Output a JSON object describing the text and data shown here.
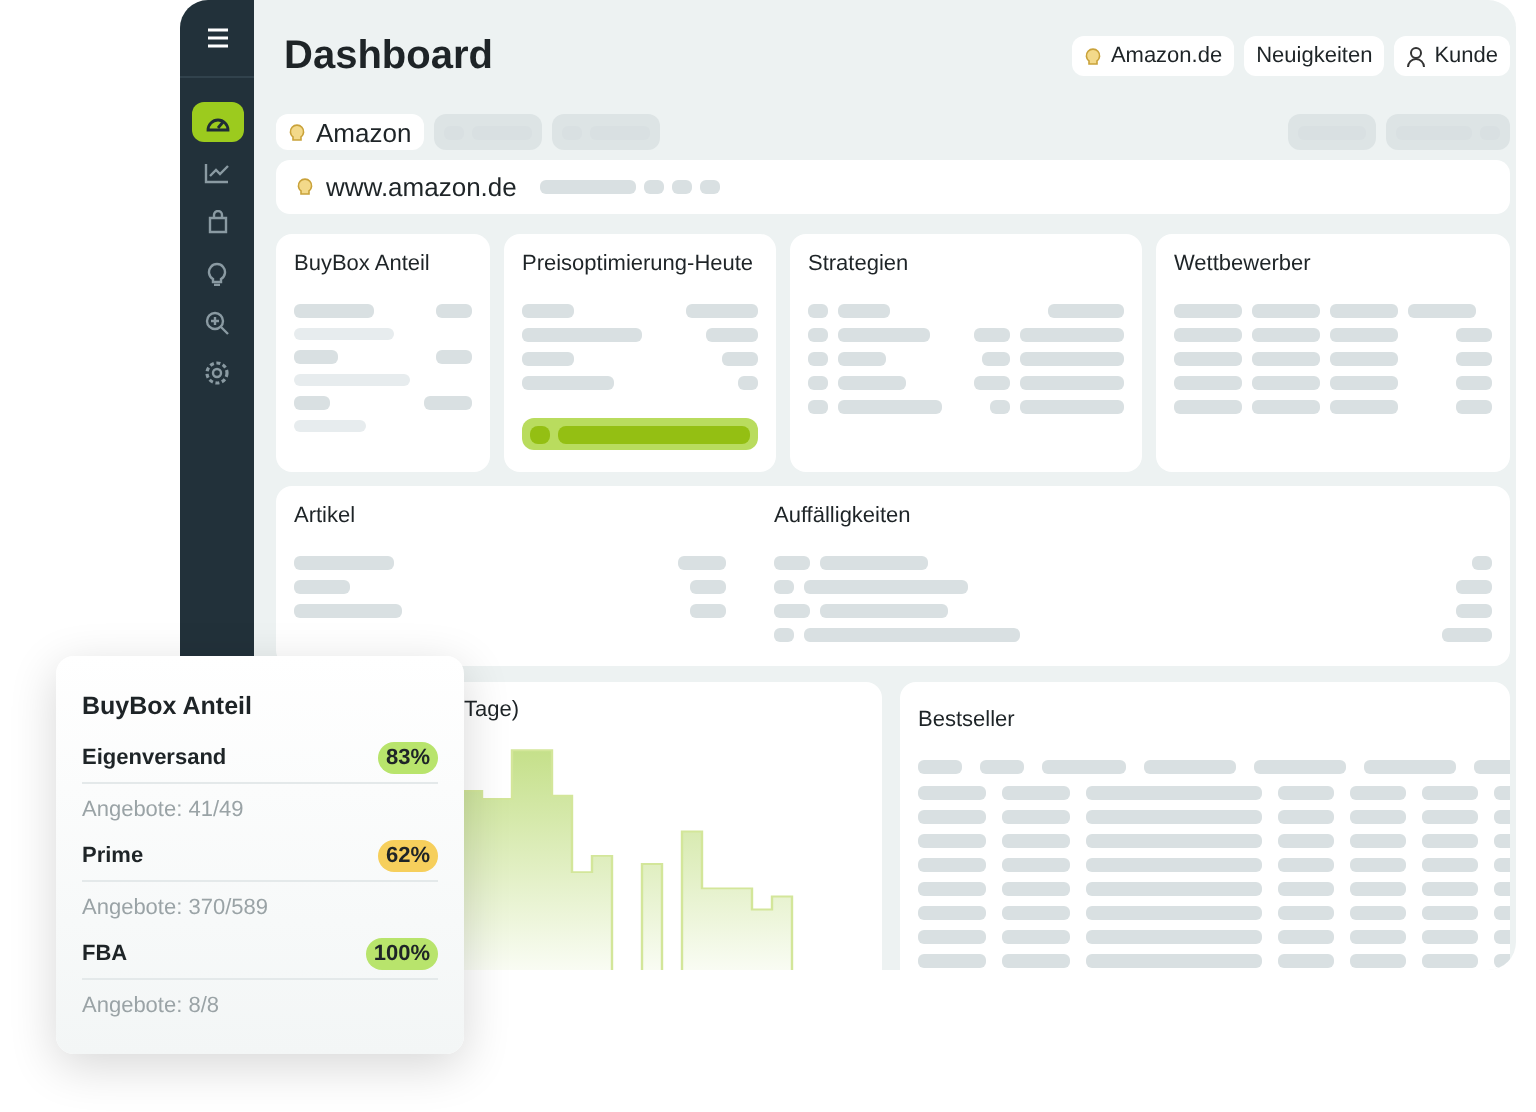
{
  "sidebar": {
    "items": [
      {
        "selected": true
      },
      {
        "selected": false
      },
      {
        "selected": false
      },
      {
        "selected": false
      },
      {
        "selected": false
      },
      {
        "selected": false
      }
    ]
  },
  "header": {
    "title": "Dashboard",
    "buttons": [
      {
        "label": "Amazon.de",
        "kind": "marketplace"
      },
      {
        "label": "Neuigkeiten",
        "kind": "plain"
      },
      {
        "label": "Kunde",
        "kind": "user"
      }
    ]
  },
  "tabs": [
    {
      "label": "Amazon",
      "selected": true
    }
  ],
  "url": "www.amazon.de",
  "cards": [
    {
      "title": "BuyBox Anteil"
    },
    {
      "title": "Preisoptimierung-Heute"
    },
    {
      "title": "Strategien"
    },
    {
      "title": "Wettbewerber"
    }
  ],
  "sections": [
    {
      "title": "Artikel"
    },
    {
      "title": "Auffälligkeiten"
    }
  ],
  "chart_title": "Tage)",
  "bestseller_title": "Bestseller",
  "popup": {
    "title": "BuyBox Anteil",
    "rows": [
      {
        "label": "Eigenversand",
        "value": "83%",
        "color": "#b8e46c",
        "offers": "Angebote: 41/49"
      },
      {
        "label": "Prime",
        "value": "62%",
        "color": "#f6cf5c",
        "offers": "Angebote: 370/589"
      },
      {
        "label": "FBA",
        "value": "100%",
        "color": "#b8e46c",
        "offers": "Angebote: 8/8"
      }
    ]
  }
}
